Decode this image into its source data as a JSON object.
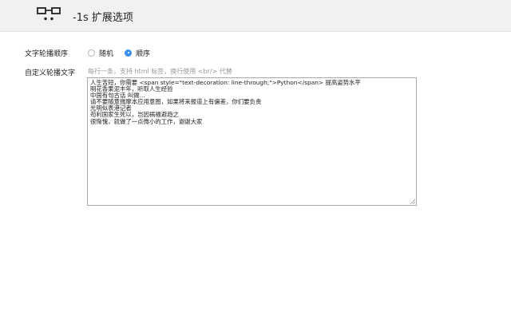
{
  "header": {
    "title": "-1s 扩展选项",
    "logo_icon": "glasses-face-icon"
  },
  "order_setting": {
    "label": "文字轮播顺序",
    "options": [
      {
        "label": "随机",
        "checked": false
      },
      {
        "label": "顺序",
        "checked": true
      }
    ],
    "accent_color": "#3b8ff0"
  },
  "custom_text": {
    "label": "自定义轮播文字",
    "hint": "每行一条，支持 html 标签，换行使用 <br/> 代替",
    "lines": [
      "人生苦短，你需要 <span style=\"text-decoration: line-through;\">Python</span> 提高姿势水平",
      "明花香果泥丰年，听取人生经验",
      "中国有句古话 叫做…",
      "请不要随意揣摩本应用意图，如果将来报道上有偏差，你们要负责",
      "光明似表港记者",
      "苟利国家生死以，岂因祸福避趋之",
      "很惭愧，就做了一点微小的工作，谢谢大家"
    ]
  }
}
